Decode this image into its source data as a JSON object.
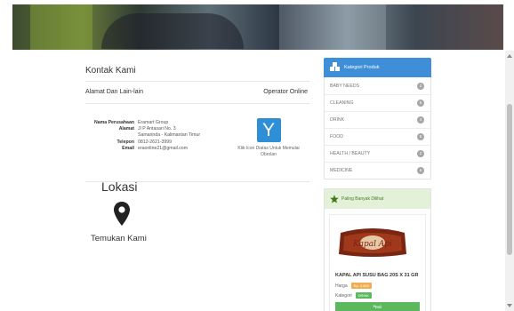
{
  "contact": {
    "title": "Kontak Kami",
    "address_heading": "Alamat Dan Lain-lain",
    "operator_heading": "Operator Online",
    "rows": [
      {
        "label": "Nama Perusahaan",
        "value": "Eramart Group"
      },
      {
        "label": "Alamat",
        "value": "Jl P Antasari No. 3"
      },
      {
        "label": "",
        "value": "Samarinda - Kalimantan Timur"
      },
      {
        "label": "Telepon",
        "value": "0812-2621-3999"
      },
      {
        "label": "Email",
        "value": "eraonline21@gmail.com"
      }
    ],
    "operator_logo_letter": "Y",
    "operator_caption": "Klik Icon Diatas Untuk Memulai Obrolan"
  },
  "location": {
    "title": "Lokasi",
    "subtitle": "Temukan Kami"
  },
  "categories": {
    "title": "Kategori Produk",
    "items": [
      {
        "label": "BABY NEEDS",
        "count": "2"
      },
      {
        "label": "CLEANING",
        "count": "5"
      },
      {
        "label": "DRINK",
        "count": "4"
      },
      {
        "label": "FOOD",
        "count": "5"
      },
      {
        "label": "HEALTH / BEAUTY",
        "count": "2"
      },
      {
        "label": "MEDICINE",
        "count": "6"
      }
    ]
  },
  "popular": {
    "title": "Paling Banyak Dilihat",
    "product": {
      "image_text": "Kapal Api",
      "name": "KAPAL API SUSU BAG 20S X 31 GR",
      "price_label": "Harga",
      "price": "Rp. 2,800",
      "category_label": "Kategori",
      "category": "DRINK",
      "button": "Beli"
    }
  },
  "colors": {
    "accent_blue": "#3f8fd8",
    "green": "#5cb85c",
    "orange": "#f0ad4e"
  }
}
